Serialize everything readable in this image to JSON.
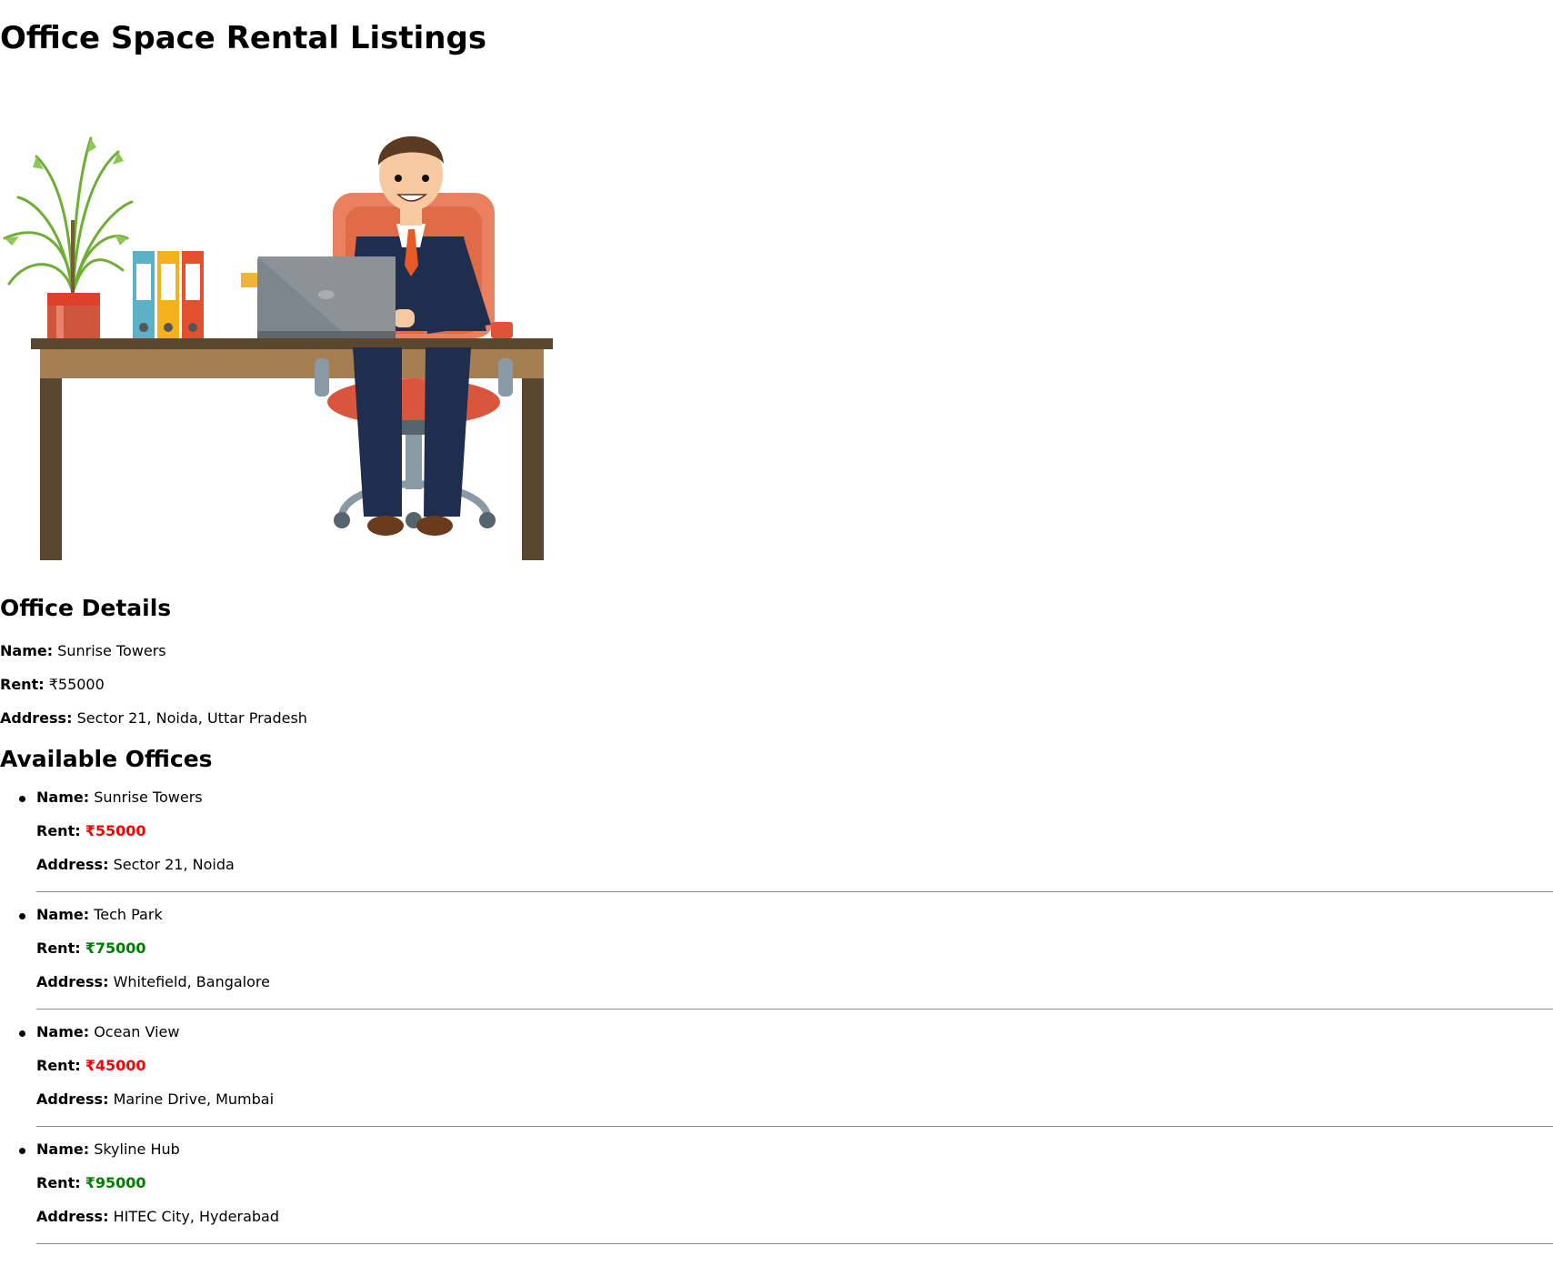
{
  "page": {
    "title": "Office Space Rental Listings"
  },
  "details": {
    "heading": "Office Details",
    "name_label": "Name:",
    "name_value": "Sunrise Towers",
    "rent_label": "Rent:",
    "rent_value": "₹55000",
    "address_label": "Address:",
    "address_value": "Sector 21, Noida, Uttar Pradesh"
  },
  "available": {
    "heading": "Available Offices",
    "name_label": "Name:",
    "rent_label": "Rent:",
    "address_label": "Address:",
    "items": [
      {
        "name": "Sunrise Towers",
        "rent": "₹55000",
        "rent_color": "#ff0000",
        "address": "Sector 21, Noida"
      },
      {
        "name": "Tech Park",
        "rent": "₹75000",
        "rent_color": "#008000",
        "address": "Whitefield, Bangalore"
      },
      {
        "name": "Ocean View",
        "rent": "₹45000",
        "rent_color": "#ff0000",
        "address": "Marine Drive, Mumbai"
      },
      {
        "name": "Skyline Hub",
        "rent": "₹95000",
        "rent_color": "#008000",
        "address": "HITEC City, Hyderabad"
      }
    ]
  },
  "icons": {
    "hero": "office-desk-illustration"
  }
}
